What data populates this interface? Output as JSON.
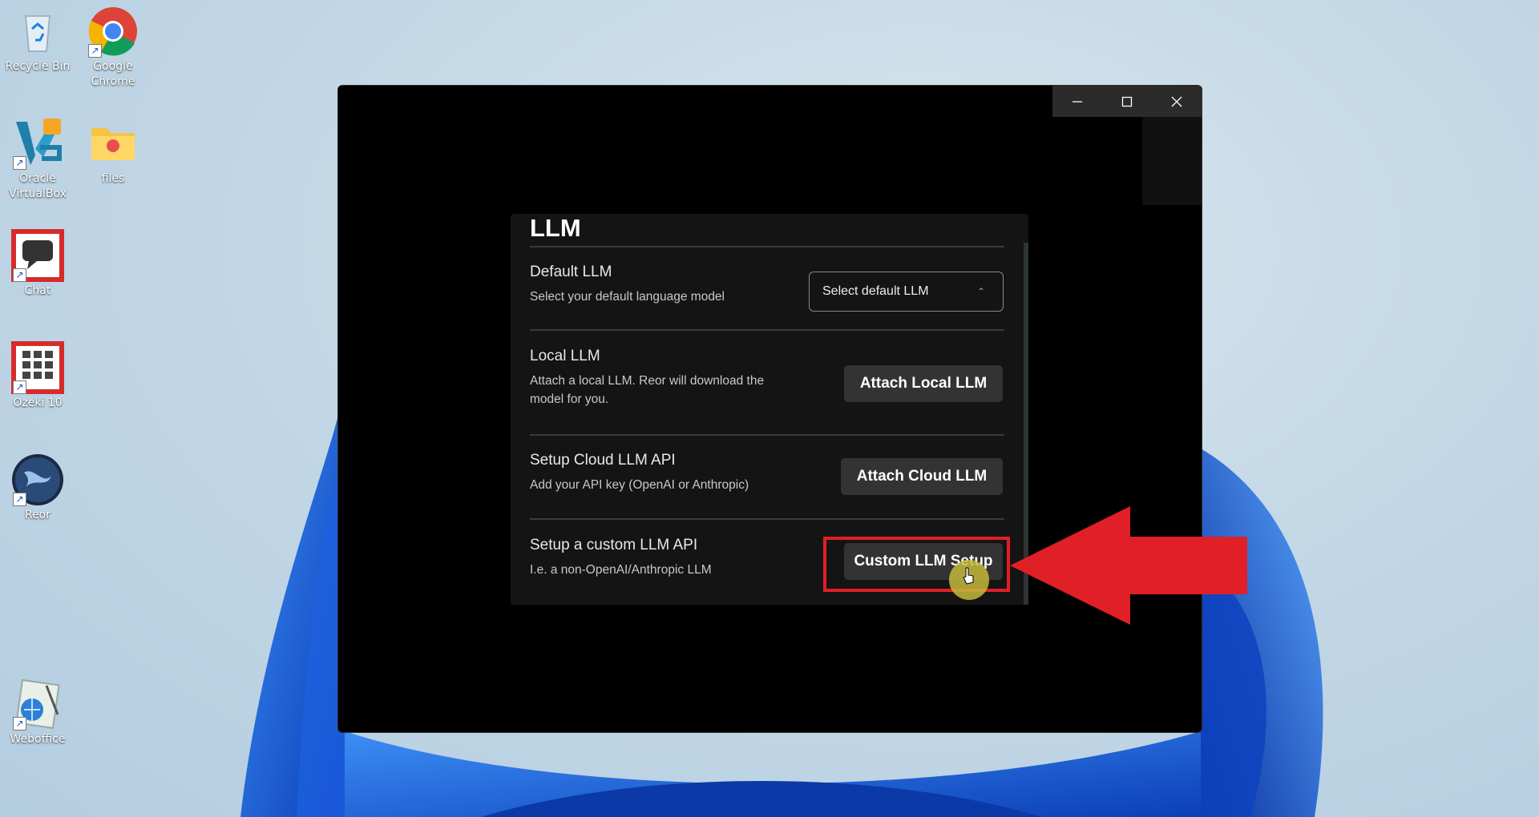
{
  "desktop": {
    "icons": [
      {
        "label": "Recycle Bin",
        "icon": "recycle-bin-icon"
      },
      {
        "label": "Google Chrome",
        "icon": "chrome-icon"
      },
      {
        "label": "Oracle VirtualBox",
        "icon": "virtualbox-icon"
      },
      {
        "label": "files",
        "icon": "folder-icon"
      },
      {
        "label": "Chat",
        "icon": "chat-icon"
      },
      {
        "label": "Ozeki 10",
        "icon": "ozeki-icon"
      },
      {
        "label": "Reor",
        "icon": "reor-icon"
      },
      {
        "label": "Weboffice",
        "icon": "weboffice-icon"
      }
    ]
  },
  "window": {
    "controls": [
      "minimize-icon",
      "maximize-icon",
      "close-icon"
    ]
  },
  "settings": {
    "title": "LLM",
    "rows": [
      {
        "title": "Default LLM",
        "desc": "Select your default language model",
        "control": "Select default LLM"
      },
      {
        "title": "Local LLM",
        "desc_line1": "Attach a local LLM. Reor will download the",
        "desc_line2": "model for you.",
        "button": "Attach Local LLM"
      },
      {
        "title": "Setup Cloud LLM API",
        "desc": "Add your API key (OpenAI or Anthropic)",
        "button": "Attach Cloud LLM"
      },
      {
        "title": "Setup a custom LLM API",
        "desc": "I.e. a non-OpenAI/Anthropic LLM",
        "button": "Custom LLM Setup"
      }
    ]
  },
  "annotation": {
    "highlight_color": "#e01f26",
    "arrow_color": "#e01f26"
  }
}
